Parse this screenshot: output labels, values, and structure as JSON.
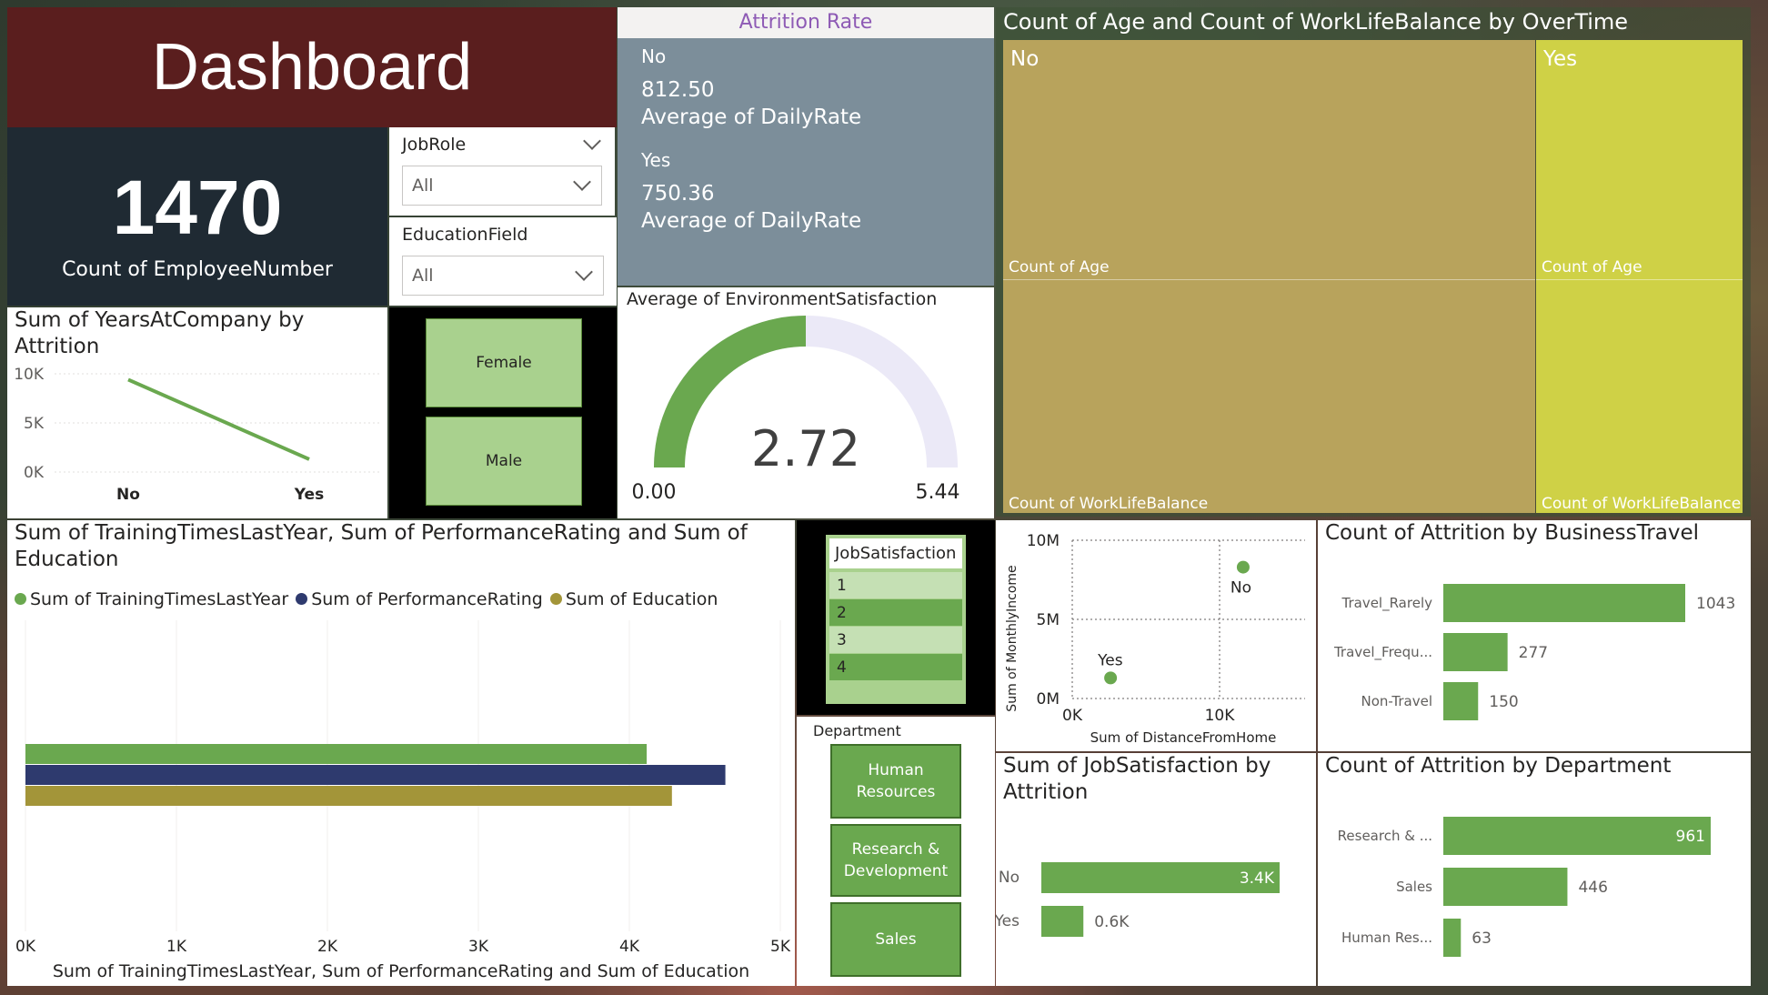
{
  "header": {
    "title": "Dashboard"
  },
  "kpi": {
    "value": "1470",
    "label": "Count of EmployeeNumber"
  },
  "filters": {
    "jobrole": {
      "label": "JobRole",
      "value": "All"
    },
    "education_field": {
      "label": "EducationField",
      "value": "All"
    }
  },
  "attrition_rate": {
    "title": "Attrition Rate",
    "items": [
      {
        "label": "No",
        "value": "812.50",
        "measure": "Average of DailyRate"
      },
      {
        "label": "Yes",
        "value": "750.36",
        "measure": "Average of DailyRate"
      }
    ]
  },
  "treemap": {
    "title": "Count of Age and Count of WorkLifeBalance by OverTime",
    "groups": [
      {
        "name": "No",
        "top": "Count of Age",
        "bottom": "Count of WorkLifeBalance",
        "color": "#b8a35c"
      },
      {
        "name": "Yes",
        "top": "Count of Age",
        "bottom": "Count of WorkLifeBalance",
        "color": "#cfd146"
      }
    ]
  },
  "years_chart": {
    "title": "Sum of YearsAtCompany by Attrition"
  },
  "gender": {
    "items": [
      "Female",
      "Male"
    ]
  },
  "gauge": {
    "title": "Average of EnvironmentSatisfaction",
    "value": "2.72",
    "min": "0.00",
    "max": "5.44",
    "fill": 0.5
  },
  "training_chart": {
    "title": "Sum of TrainingTimesLastYear, Sum of PerformanceRating and Sum of Education"
  },
  "job_satisfaction": {
    "label": "JobSatisfaction",
    "items": [
      "1",
      "2",
      "3",
      "4"
    ]
  },
  "department_slicer": {
    "label": "Department",
    "items": [
      "Human Resources",
      "Research & Development",
      "Sales"
    ]
  },
  "scatter_chart": {},
  "business_travel": {
    "title": "Count of Attrition by BusinessTravel"
  },
  "js_attrition": {
    "title": "Sum of JobSatisfaction by Attrition"
  },
  "department_chart": {
    "title": "Count of Attrition by Department"
  },
  "colors": {
    "green": "#6aa84f",
    "navy": "#2e3a6e",
    "gold": "#a39539",
    "header_bg": "#5a1e1e"
  },
  "chart_data": [
    {
      "type": "line",
      "title": "Sum of YearsAtCompany by Attrition",
      "categories": [
        "No",
        "Yes"
      ],
      "values": [
        9400,
        1300
      ],
      "yticks": [
        "10K",
        "5K",
        "0K"
      ],
      "ylim": [
        0,
        10000
      ]
    },
    {
      "type": "bar",
      "orientation": "horizontal",
      "title": "Sum of TrainingTimesLastYear, Sum of PerformanceRating and Sum of Education",
      "xlabel": "Sum of TrainingTimesLastYear, Sum of PerformanceRating and Sum of Education",
      "series": [
        {
          "name": "Sum of TrainingTimesLastYear",
          "values": [
            4115
          ],
          "color": "#6aa84f"
        },
        {
          "name": "Sum of PerformanceRating",
          "values": [
            4636
          ],
          "color": "#2e3a6e"
        },
        {
          "name": "Sum of Education",
          "values": [
            4282
          ],
          "color": "#a39539"
        }
      ],
      "xticks": [
        "0K",
        "1K",
        "2K",
        "3K",
        "4K",
        "5K"
      ],
      "xlim": [
        0,
        5000
      ],
      "legend": "top-left"
    },
    {
      "type": "scatter",
      "xlabel": "Sum of DistanceFromHome",
      "ylabel": "Sum of MonthlyIncome",
      "points": [
        {
          "label": "No",
          "x": 11600,
          "y": 8300000
        },
        {
          "label": "Yes",
          "x": 2600,
          "y": 1300000
        }
      ],
      "xticks": [
        "0K",
        "10K"
      ],
      "yticks": [
        "10M",
        "5M",
        "0M"
      ],
      "xlim": [
        0,
        15000
      ],
      "ylim": [
        0,
        10000000
      ]
    },
    {
      "type": "bar",
      "orientation": "horizontal",
      "title": "Count of Attrition by BusinessTravel",
      "categories": [
        "Travel_Rarely",
        "Travel_Frequ...",
        "Non-Travel"
      ],
      "values": [
        1043,
        277,
        150
      ],
      "labels": [
        "1043",
        "277",
        "150"
      ]
    },
    {
      "type": "bar",
      "orientation": "horizontal",
      "title": "Sum of JobSatisfaction by Attrition",
      "categories": [
        "No",
        "Yes"
      ],
      "values": [
        3400,
        600
      ],
      "labels": [
        "3.4K",
        "0.6K"
      ]
    },
    {
      "type": "bar",
      "orientation": "horizontal",
      "title": "Count of Attrition by Department",
      "categories": [
        "Research & ...",
        "Sales",
        "Human Res..."
      ],
      "values": [
        961,
        446,
        63
      ],
      "labels": [
        "961",
        "446",
        "63"
      ]
    }
  ]
}
